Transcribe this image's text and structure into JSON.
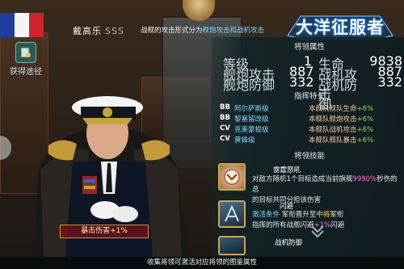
{
  "header": {
    "name": "戴高乐",
    "rank": "SSS",
    "attack_type_prefix": "战舰的攻击形式分为",
    "attack_type_highlight": "舰炮攻击和战机攻击"
  },
  "logo": {
    "text": "大洋征服者"
  },
  "left_menu": {
    "get_route_label": "获得途径"
  },
  "flag": {
    "colors": [
      "#1f3fa6",
      "#ffffff",
      "#d7232b"
    ]
  },
  "stats": {
    "title": "将领属性",
    "rows": [
      {
        "l1": "等级",
        "v1": "1",
        "l2": "生命",
        "v2": "9838"
      },
      {
        "l1": "舰炮攻击",
        "v1": "887",
        "l2": "战机攻击",
        "v2": "887"
      },
      {
        "l1": "舰炮防御",
        "v1": "332",
        "l2": "战机防御",
        "v2": "332"
      }
    ]
  },
  "specialty": {
    "title": "指挥特长",
    "rows": [
      {
        "type": "BB",
        "ship": "阿尔萨斯级",
        "effect": "本舰队舰队生命",
        "bonus": "+6%"
      },
      {
        "type": "BB",
        "ship": "黎塞留改级",
        "effect": "本舰队舰炮攻击",
        "bonus": "+6%"
      },
      {
        "type": "CV",
        "ship": "克莱蒙梭级",
        "effect": "本舰队战机攻击",
        "bonus": "+6%"
      },
      {
        "type": "CV",
        "ship": "黄蜂级",
        "effect": "本舰队舰队暴击",
        "bonus": "+6%"
      }
    ]
  },
  "skills": {
    "title": "将领技能",
    "items": [
      {
        "name": "雷霆怒吼",
        "desc_line1_prefix": "对敌方随机1个目标造成当前旗舰",
        "desc_line1_highlight": "9990%",
        "desc_line1_suffix": "秒伤的总",
        "desc_line2": "的目标共同分担该伤害"
      },
      {
        "name": "闪避",
        "desc_line1_prefix": "激活条件",
        "desc_line1_mid": "军衔晋升至",
        "desc_line1_highlight": "中将",
        "desc_line1_suffix": "军衔",
        "desc_line2_prefix": "指挥的所有战舰闪避",
        "desc_line2_bonus": "+1%",
        "desc_line2_suffix": "闪避"
      },
      {
        "name": "战机防御"
      }
    ]
  },
  "crit_banner": {
    "label": "暴击伤害",
    "bonus": "+1%"
  },
  "bottom_bar": {
    "text": "收集将领可激活对应将领的图鉴属性"
  }
}
